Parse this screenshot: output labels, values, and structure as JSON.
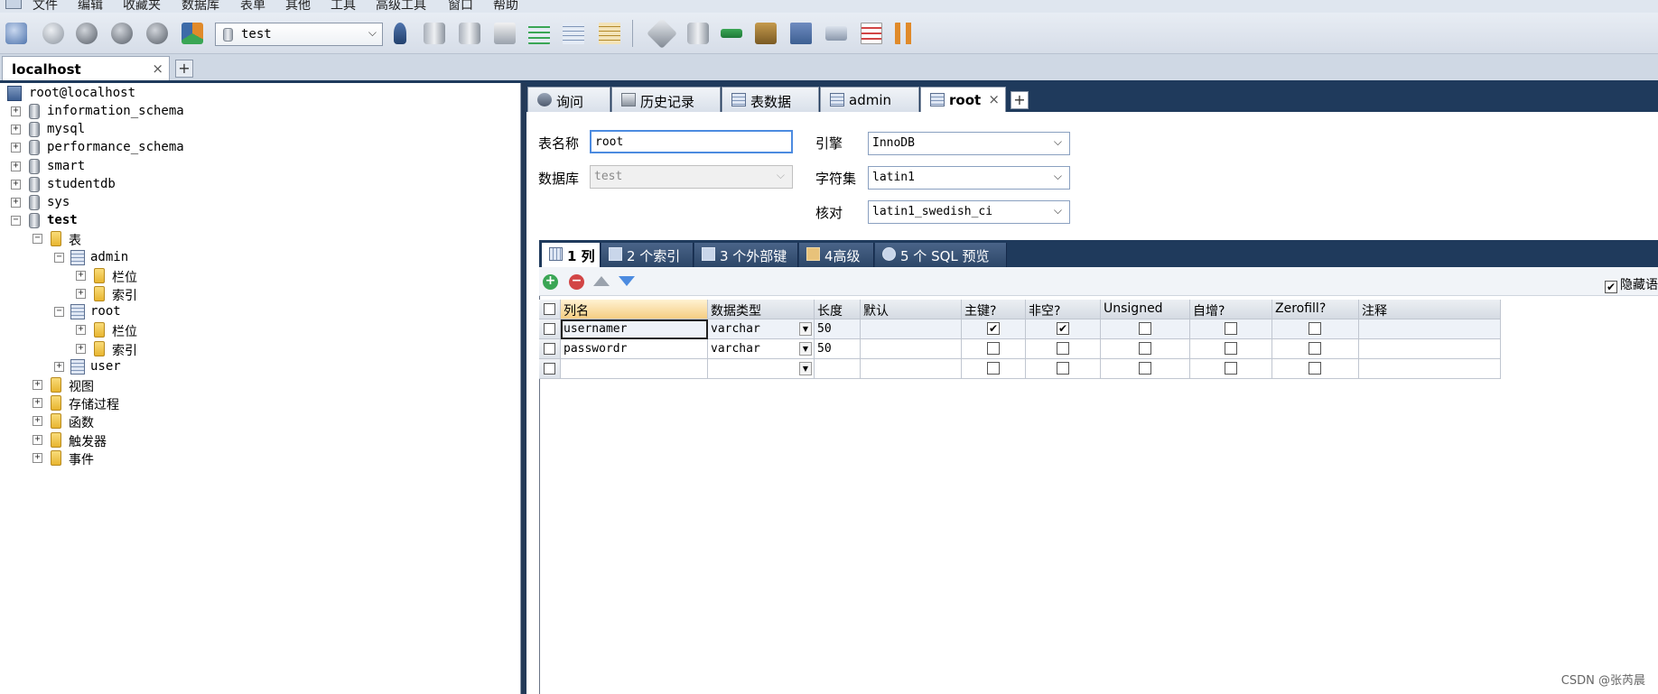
{
  "menu": [
    "文件",
    "编辑",
    "收藏夹",
    "数据库",
    "表单",
    "其他",
    "工具",
    "高级工具",
    "窗口",
    "帮助"
  ],
  "toolbar": {
    "database_selector_value": "test",
    "colors": {
      "green": "#3aa655",
      "gray": "#6f7782",
      "blue": "#3d6ba8",
      "orange": "#e08a2a"
    }
  },
  "connection_tab": {
    "label": "localhost",
    "close": "×",
    "add": "+"
  },
  "tree": {
    "root": "root@localhost",
    "nodes": [
      {
        "label": "information_schema",
        "expander": "+"
      },
      {
        "label": "mysql",
        "expander": "+"
      },
      {
        "label": "performance_schema",
        "expander": "+"
      },
      {
        "label": "smart",
        "expander": "+"
      },
      {
        "label": "studentdb",
        "expander": "+"
      },
      {
        "label": "sys",
        "expander": "+"
      },
      {
        "label": "test",
        "expander": "−"
      },
      {
        "label": "表",
        "expander": "−"
      },
      {
        "label": "admin",
        "expander": "−"
      },
      {
        "label": "栏位",
        "expander": "+"
      },
      {
        "label": "索引",
        "expander": "+"
      },
      {
        "label": "root",
        "expander": "−"
      },
      {
        "label": "栏位",
        "expander": "+"
      },
      {
        "label": "索引",
        "expander": "+"
      },
      {
        "label": "user",
        "expander": "+"
      },
      {
        "label": "视图",
        "expander": "+"
      },
      {
        "label": "存储过程",
        "expander": "+"
      },
      {
        "label": "函数",
        "expander": "+"
      },
      {
        "label": "触发器",
        "expander": "+"
      },
      {
        "label": "事件",
        "expander": "+"
      }
    ]
  },
  "object_tabs": [
    {
      "label": "询问",
      "icon": "query-icon"
    },
    {
      "label": "历史记录",
      "icon": "history-icon"
    },
    {
      "label": "表数据",
      "icon": "table-data-icon"
    },
    {
      "label": "admin",
      "icon": "table-icon"
    },
    {
      "label": "root",
      "icon": "table-edit-icon",
      "close": "×"
    }
  ],
  "object_tab_add": "+",
  "form": {
    "table_name_label": "表名称",
    "table_name_value": "root",
    "database_label": "数据库",
    "database_value": "test",
    "engine_label": "引擎",
    "engine_value": "InnoDB",
    "charset_label": "字符集",
    "charset_value": "latin1",
    "collation_label": "核对",
    "collation_value": "latin1_swedish_ci"
  },
  "sub_tabs": [
    {
      "label": "1 列",
      "active": true
    },
    {
      "label": "2 个索引",
      "active": false
    },
    {
      "label": "3 个外部键",
      "active": false
    },
    {
      "label": "4高级",
      "active": false
    },
    {
      "label": "5 个 SQL 预览",
      "active": false
    }
  ],
  "grid_toolbar": {
    "add": "+",
    "remove": "−",
    "hide_label": "隐藏语"
  },
  "grid": {
    "headers": [
      "列名",
      "数据类型",
      "长度",
      "默认",
      "主键?",
      "非空?",
      "Unsigned",
      "自增?",
      "Zerofill?",
      "注释"
    ],
    "rows": [
      {
        "name": "usernamer",
        "type": "varchar",
        "length": "50",
        "default": "",
        "pk": true,
        "notnull": true,
        "unsigned": false,
        "autoinc": false,
        "zerofill": false,
        "comment": ""
      },
      {
        "name": "passwordr",
        "type": "varchar",
        "length": "50",
        "default": "",
        "pk": false,
        "notnull": false,
        "unsigned": false,
        "autoinc": false,
        "zerofill": false,
        "comment": ""
      },
      {
        "name": "",
        "type": "",
        "length": "",
        "default": "",
        "pk": false,
        "notnull": false,
        "unsigned": false,
        "autoinc": false,
        "zerofill": false,
        "comment": ""
      }
    ]
  },
  "watermark": "CSDN @张芮晨"
}
